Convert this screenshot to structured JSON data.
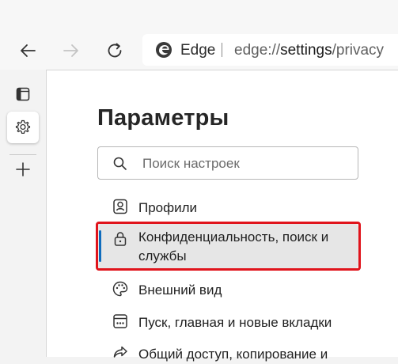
{
  "toolbar": {
    "back_icon": "back-arrow-icon",
    "forward_icon": "forward-arrow-icon",
    "refresh_icon": "refresh-icon",
    "address_bar": {
      "site_label": "Edge",
      "url_prefix": "edge://",
      "url_host": "settings",
      "url_path": "/privacy"
    }
  },
  "vertical_tabs": {
    "items": [
      {
        "icon": "tab-actions-icon"
      },
      {
        "icon": "gear-icon",
        "active": true
      },
      {
        "icon": "plus-icon"
      }
    ]
  },
  "settings": {
    "title": "Параметры",
    "search": {
      "placeholder": "Поиск настроек"
    },
    "menu": [
      {
        "label": "Профили",
        "icon": "profile-icon"
      },
      {
        "label": "Конфиденциальность, поиск и",
        "label2": "службы",
        "icon": "lock-icon",
        "selected": true
      },
      {
        "label": "Внешний вид",
        "icon": "palette-icon"
      },
      {
        "label": "Пуск, главная и новые вкладки",
        "icon": "home-tabs-icon"
      },
      {
        "label": "Общий доступ, копирование и",
        "icon": "share-icon"
      }
    ]
  },
  "colors": {
    "accent": "#0f6cbd",
    "highlight_border": "#e0141c",
    "selected_bg": "#e6e6e6"
  }
}
